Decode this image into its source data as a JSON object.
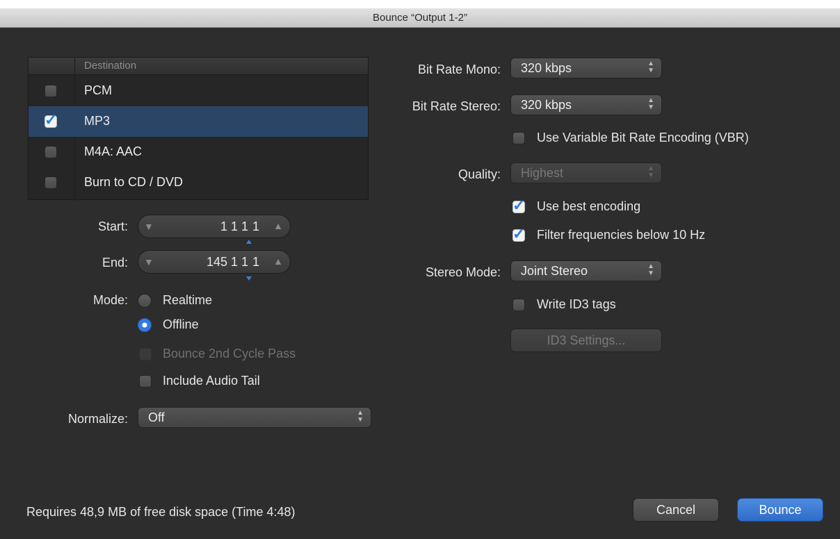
{
  "window": {
    "title": "Bounce “Output 1-2”"
  },
  "destination": {
    "header": "Destination",
    "rows": [
      {
        "label": "PCM",
        "checked": false,
        "selected": false
      },
      {
        "label": "MP3",
        "checked": true,
        "selected": true
      },
      {
        "label": "M4A: AAC",
        "checked": false,
        "selected": false
      },
      {
        "label": "Burn to CD / DVD",
        "checked": false,
        "selected": false
      }
    ]
  },
  "range": {
    "start_label": "Start:",
    "start_value": "1 1 1",
    "start_tick": "1",
    "end_label": "End:",
    "end_value": "145 1 1",
    "end_tick": "1"
  },
  "mode": {
    "label": "Mode:",
    "realtime": "Realtime",
    "offline": "Offline",
    "selected": "Offline",
    "second_cycle": "Bounce 2nd Cycle Pass",
    "audio_tail": "Include Audio Tail"
  },
  "normalize": {
    "label": "Normalize:",
    "value": "Off"
  },
  "mp3": {
    "bitrate_mono_label": "Bit Rate Mono:",
    "bitrate_mono_value": "320 kbps",
    "bitrate_stereo_label": "Bit Rate Stereo:",
    "bitrate_stereo_value": "320 kbps",
    "vbr_label": "Use Variable Bit Rate Encoding (VBR)",
    "quality_label": "Quality:",
    "quality_value": "Highest",
    "best_encoding_label": "Use best encoding",
    "filter_label": "Filter frequencies below 10 Hz",
    "stereo_mode_label": "Stereo Mode:",
    "stereo_mode_value": "Joint Stereo",
    "id3_tags_label": "Write ID3 tags",
    "id3_settings_label": "ID3 Settings..."
  },
  "footer": {
    "info": "Requires 48,9 MB of free disk space  (Time 4:48)",
    "cancel": "Cancel",
    "bounce": "Bounce"
  },
  "colors": {
    "accent": "#2f7be0",
    "selection": "#2b4566",
    "background": "#2d2d2d"
  }
}
